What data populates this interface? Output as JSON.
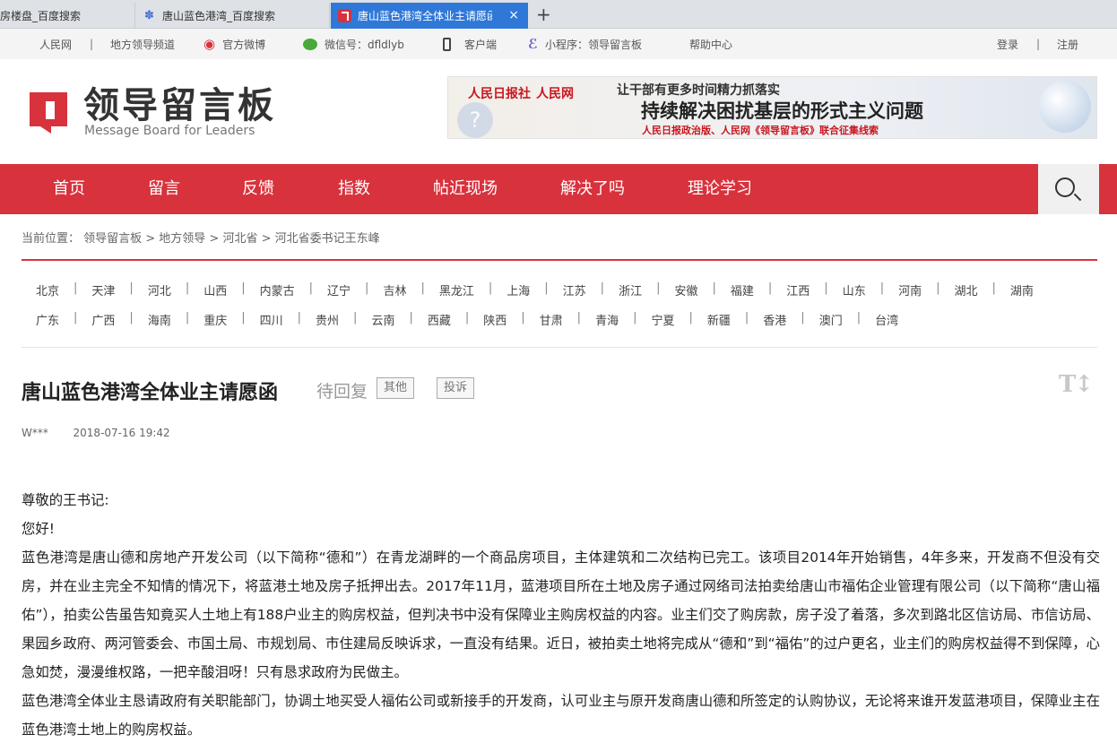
{
  "browser": {
    "tabs": [
      {
        "title": "房楼盘_百度搜索"
      },
      {
        "title": "唐山蓝色港湾_百度搜索"
      },
      {
        "title": "唐山蓝色港湾全体业主请愿函"
      }
    ],
    "new_tab": "+",
    "close": "×"
  },
  "utilbar": {
    "people": "人民网",
    "local_channel": "地方领导频道",
    "weibo": "官方微博",
    "wechat": "微信号：dfldlyb",
    "client": "客户端",
    "miniprogram": "小程序：领导留言板",
    "help": "帮助中心",
    "login": "登录",
    "register": "注册",
    "sep": "|"
  },
  "header": {
    "logo_cn": "领导留言板",
    "logo_en": "Message Board for Leaders",
    "banner": {
      "logo1": "人民日报社",
      "logo2": "人民网",
      "line1": "让干部有更多时间精力抓落实",
      "line2": "持续解决困扰基层的形式主义问题",
      "line3": "人民日报政治版、人民网《领导留言板》联合征集线索"
    }
  },
  "nav": {
    "items": [
      "首页",
      "留言",
      "反馈",
      "指数",
      "帖近现场",
      "解决了吗",
      "理论学习"
    ]
  },
  "breadcrumb": "当前位置： 领导留言板 > 地方领导 > 河北省 > 河北省委书记王东峰",
  "provinces": {
    "row1": [
      "北京",
      "天津",
      "河北",
      "山西",
      "内蒙古",
      "辽宁",
      "吉林",
      "黑龙江",
      "上海",
      "江苏",
      "浙江",
      "安徽",
      "福建",
      "江西",
      "山东",
      "河南",
      "湖北",
      "湖南"
    ],
    "row2": [
      "广东",
      "广西",
      "海南",
      "重庆",
      "四川",
      "贵州",
      "云南",
      "西藏",
      "陕西",
      "甘肃",
      "青海",
      "宁夏",
      "新疆",
      "香港",
      "澳门",
      "台湾"
    ],
    "sep": "|"
  },
  "post": {
    "title": "唐山蓝色港湾全体业主请愿函",
    "status": "待回复",
    "tag1": "其他",
    "tag2": "投诉",
    "font_toggle": "T↕",
    "author": "W***",
    "date": "2018-07-16 19:42",
    "greeting": "尊敬的王书记:",
    "hello": "您好!",
    "para1": "蓝色港湾是唐山德和房地产开发公司（以下简称“德和”）在青龙湖畔的一个商品房项目，主体建筑和二次结构已完工。该项目2014年开始销售，4年多来，开发商不但没有交房，并在业主完全不知情的情况下，将蓝港土地及房子抵押出去。2017年11月，蓝港项目所在土地及房子通过网络司法拍卖给唐山市福佑企业管理有限公司（以下简称“唐山福佑”），拍卖公告虽告知竟买人土地上有188户业主的购房权益，但判决书中没有保障业主购房权益的内容。业主们交了购房款，房子没了着落，多次到路北区信访局、市信访局、果园乡政府、两河管委会、市国土局、市规划局、市住建局反映诉求，一直没有结果。近日，被拍卖土地将完成从“德和”到“福佑”的过户更名，业主们的购房权益得不到保障，心急如焚，漫漫维权路，一把辛酸泪呀！只有恳求政府为民做主。",
    "para2": "蓝色港湾全体业主恳请政府有关职能部门，协调土地买受人福佑公司或新接手的开发商，认可业主与原开发商唐山德和所签定的认购协议，无论将来谁开发蓝港项目，保障业主在蓝色港湾土地上的购房权益。"
  }
}
